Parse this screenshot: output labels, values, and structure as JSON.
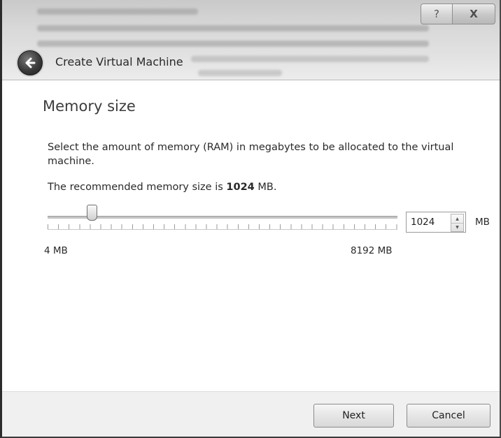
{
  "window": {
    "title": "Create Virtual Machine",
    "help_glyph": "?",
    "close_glyph": "X"
  },
  "page": {
    "heading": "Memory size",
    "description": "Select the amount of memory (RAM) in megabytes to be allocated to the virtual machine.",
    "recommended_prefix": "The recommended memory size is ",
    "recommended_value": "1024",
    "recommended_suffix": " MB."
  },
  "memory": {
    "value": "1024",
    "unit": "MB",
    "min_label": "4 MB",
    "max_label": "8192 MB",
    "slider_min_mb": 4,
    "slider_max_mb": 8192,
    "slider_value_mb": 1024
  },
  "footer": {
    "next_label": "Next",
    "cancel_label": "Cancel"
  }
}
